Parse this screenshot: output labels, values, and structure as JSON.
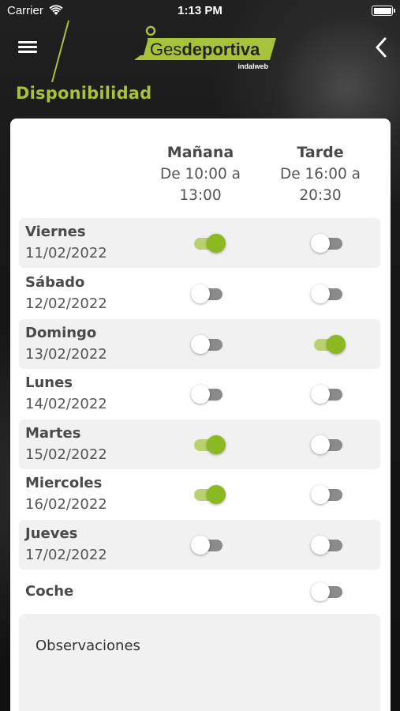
{
  "status_bar": {
    "carrier": "Carrier",
    "time": "1:13 PM"
  },
  "header": {
    "logo_ges": "Ges",
    "logo_deportiva": "deportiva",
    "logo_sub": "indalweb",
    "title": "Disponibilidad"
  },
  "columns": {
    "morning": {
      "title": "Mañana",
      "line1": "De 10:00 a",
      "line2": "13:00"
    },
    "afternoon": {
      "title": "Tarde",
      "line1": "De 16:00 a",
      "line2": "20:30"
    }
  },
  "days": [
    {
      "name": "Viernes",
      "date": "11/02/2022",
      "morning": true,
      "afternoon": false
    },
    {
      "name": "Sábado",
      "date": "12/02/2022",
      "morning": false,
      "afternoon": false
    },
    {
      "name": "Domingo",
      "date": "13/02/2022",
      "morning": false,
      "afternoon": true
    },
    {
      "name": "Lunes",
      "date": "14/02/2022",
      "morning": false,
      "afternoon": false
    },
    {
      "name": "Martes",
      "date": "15/02/2022",
      "morning": true,
      "afternoon": false
    },
    {
      "name": "Miercoles",
      "date": "16/02/2022",
      "morning": true,
      "afternoon": false
    },
    {
      "name": "Jueves",
      "date": "17/02/2022",
      "morning": false,
      "afternoon": false
    }
  ],
  "coche": {
    "label": "Coche",
    "value": false
  },
  "observaciones": {
    "label": "Observaciones"
  },
  "colors": {
    "accent": "#a6c23a",
    "toggle_on_knob": "#8cb822",
    "toggle_on_track": "#b9d16f",
    "toggle_off_track": "#8a8a8a"
  }
}
